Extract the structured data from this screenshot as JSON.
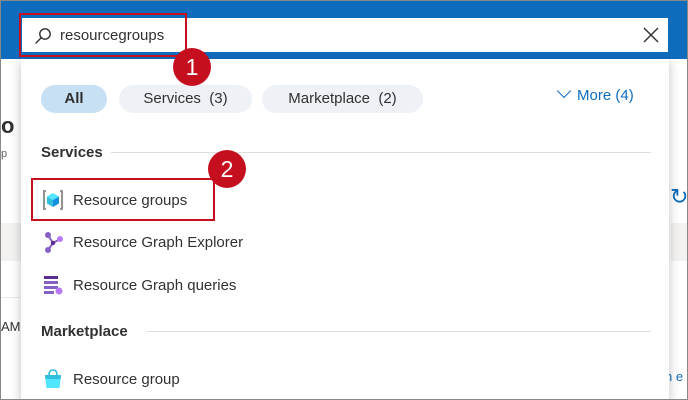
{
  "search": {
    "value": "resourcegroups",
    "icon": "search-icon",
    "clear_icon": "close-icon"
  },
  "filters": {
    "all_label": "All",
    "services_label": "Services",
    "services_count": "(3)",
    "marketplace_label": "Marketplace",
    "marketplace_count": "(2)",
    "more_label": "More",
    "more_count": "(4)"
  },
  "sections": {
    "services_heading": "Services",
    "marketplace_heading": "Marketplace"
  },
  "services": [
    {
      "label": "Resource groups",
      "icon": "resource-groups-icon"
    },
    {
      "label": "Resource Graph Explorer",
      "icon": "resource-graph-explorer-icon"
    },
    {
      "label": "Resource Graph queries",
      "icon": "resource-graph-queries-icon"
    }
  ],
  "marketplace": [
    {
      "label": "Resource group",
      "icon": "marketplace-bag-icon"
    }
  ],
  "annotations": {
    "step1": "1",
    "step2": "2"
  },
  "background": {
    "title_fragment": "o",
    "subtitle_fragment": "p",
    "am_fragment": "AM",
    "right_fragment": "n e"
  },
  "colors": {
    "accent": "#0f6cbd",
    "highlight": "#c50f1f",
    "pill_active": "#c7e0f4",
    "pill_inactive": "#eef2f7"
  }
}
